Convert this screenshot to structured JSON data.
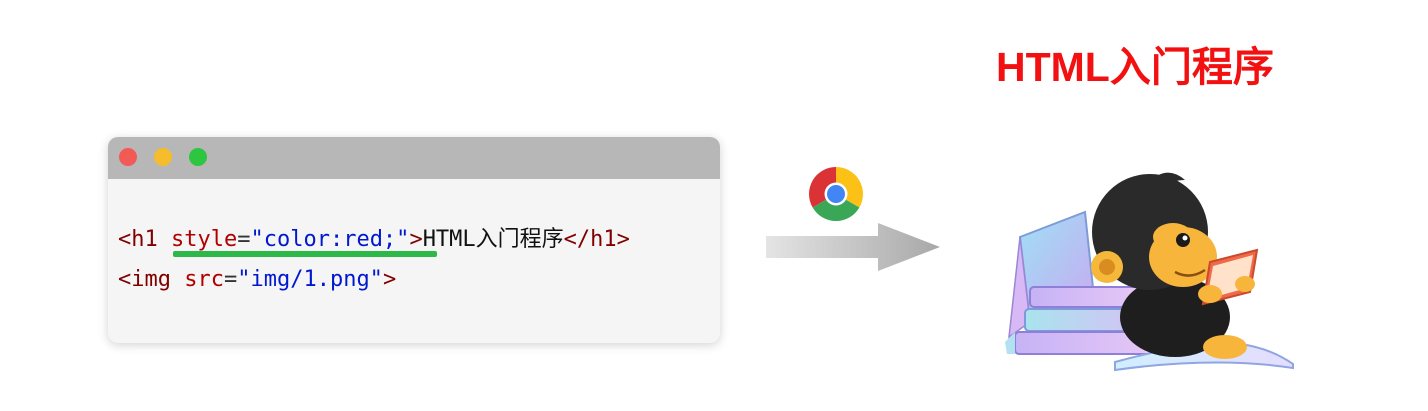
{
  "code": {
    "line1": {
      "open": "<h1",
      "attr": "style",
      "eq": "=",
      "value": "\"color:red;\"",
      "close": ">",
      "text": "HTML入门程序",
      "end": "</h1>"
    },
    "line2": {
      "open": "<img",
      "attr": "src",
      "eq": "=",
      "value": "\"img/1.png\"",
      "close": ">"
    }
  },
  "output": {
    "title": "HTML入门程序"
  },
  "icons": {
    "browser": "chrome-icon",
    "arrow": "arrow-right-icon",
    "image": "mascot-reading-books-illustration"
  },
  "colors": {
    "title": "#f21010",
    "highlight": "#2fb84a",
    "tag": "#800000",
    "attr": "#b00000",
    "string": "#0018d0"
  }
}
